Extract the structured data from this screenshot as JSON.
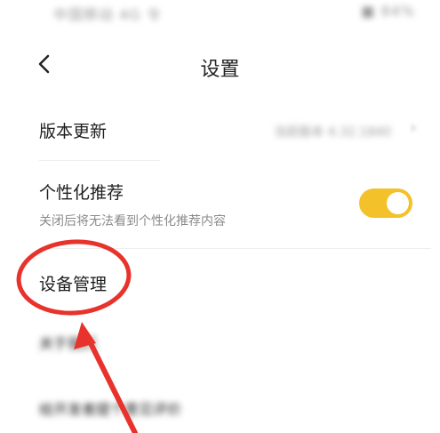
{
  "status_bar": {
    "left": "中国移动 4G 令",
    "right": "■ 84%"
  },
  "header": {
    "title": "设置",
    "back_icon": "chevron-left-icon"
  },
  "rows": {
    "version_update": {
      "label": "版本更新",
      "value": "当前版本 4.32.1840",
      "chevron": "chevron-right-icon"
    },
    "personalized": {
      "label": "个性化推荐",
      "subtitle": "关闭后将无法看到个性化推荐内容",
      "toggle_on": true,
      "accent": "#f3c12a"
    },
    "device_manage": {
      "label": "设备管理"
    },
    "blurred_row_1": {
      "label": "关于我们"
    },
    "blurred_row_2": {
      "label": "给开发者提个意见评价"
    }
  },
  "annotation": {
    "color": "#e8322c",
    "shapes": [
      "circle",
      "arrow"
    ]
  }
}
